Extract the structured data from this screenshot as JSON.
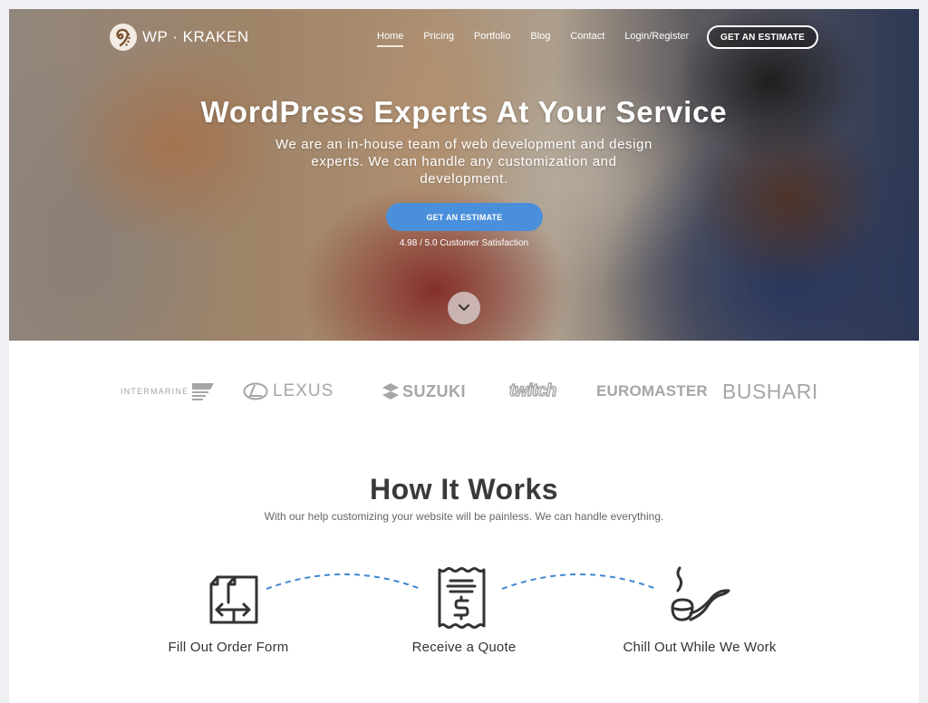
{
  "header": {
    "logo_text": "WP · KRAKEN",
    "nav": [
      {
        "label": "Home",
        "active": true
      },
      {
        "label": "Pricing",
        "active": false
      },
      {
        "label": "Portfolio",
        "active": false
      },
      {
        "label": "Blog",
        "active": false
      },
      {
        "label": "Contact",
        "active": false
      },
      {
        "label": "Login/Register",
        "active": false
      }
    ],
    "cta_label": "GET AN ESTIMATE"
  },
  "hero": {
    "title": "WordPress Experts At Your Service",
    "subtitle": "We are an in-house team of web development and design experts. We can handle any customization and development.",
    "cta_label": "GET AN ESTIMATE",
    "rating_text": "4.98 / 5.0 Customer Satisfaction",
    "scroll_icon": "chevron-down-icon"
  },
  "clients": [
    {
      "name": "INTERMARINE"
    },
    {
      "name": "LEXUS"
    },
    {
      "name": "SUZUKI"
    },
    {
      "name": "twitch"
    },
    {
      "name": "EUROMASTER"
    },
    {
      "name": "BUSHARI"
    }
  ],
  "how_it_works": {
    "title": "How It Works",
    "subtitle": "With our help customizing your website will be painless. We can handle everything.",
    "steps": [
      {
        "label": "Fill Out Order Form",
        "icon": "order-form-icon"
      },
      {
        "label": "Receive a Quote",
        "icon": "receipt-dollar-icon"
      },
      {
        "label": "Chill Out While We Work",
        "icon": "smoking-pipe-icon"
      }
    ]
  },
  "colors": {
    "accent": "#4a8fdb",
    "heading": "#3a3a3a",
    "logo_gray": "#a6a6a6",
    "page_bg": "#eef0f3"
  }
}
